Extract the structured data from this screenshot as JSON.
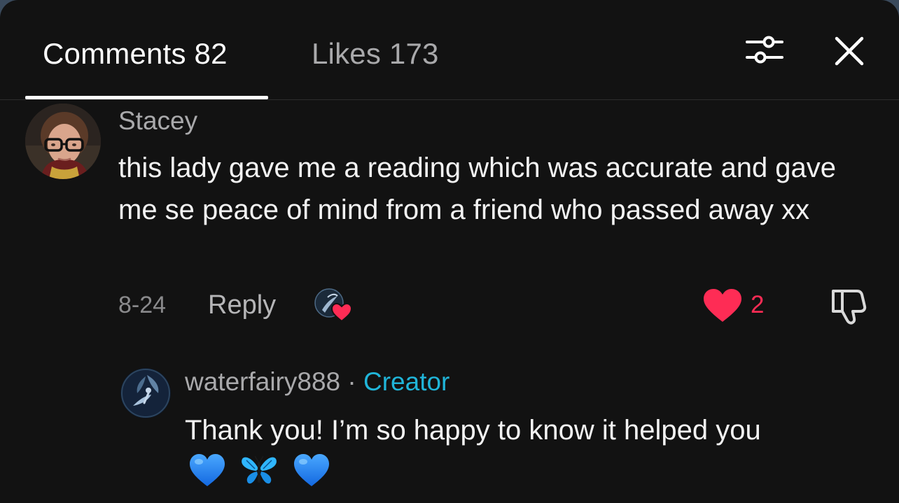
{
  "tabs": {
    "comments_label": "Comments 82",
    "likes_label": "Likes 173"
  },
  "header_icons": {
    "filter": "sliders-icon",
    "close": "close-icon"
  },
  "comments": [
    {
      "username": "Stacey",
      "text": "this lady gave me a reading which was accurate and gave me se peace of mind from a friend who passed away xx",
      "date": "8-24",
      "reply_label": "Reply",
      "like_count": "2",
      "liked_by_creator": true,
      "reply": {
        "username": "waterfairy888",
        "separator": "·",
        "badge": "Creator",
        "text": "Thank you! I’m so happy to know it helped you",
        "emojis": [
          "blue-heart-emoji",
          "butterfly-emoji",
          "blue-heart-emoji"
        ]
      }
    }
  ],
  "colors": {
    "background": "#121212",
    "like_red": "#fe2c55",
    "creator_badge": "#20b5d9"
  }
}
